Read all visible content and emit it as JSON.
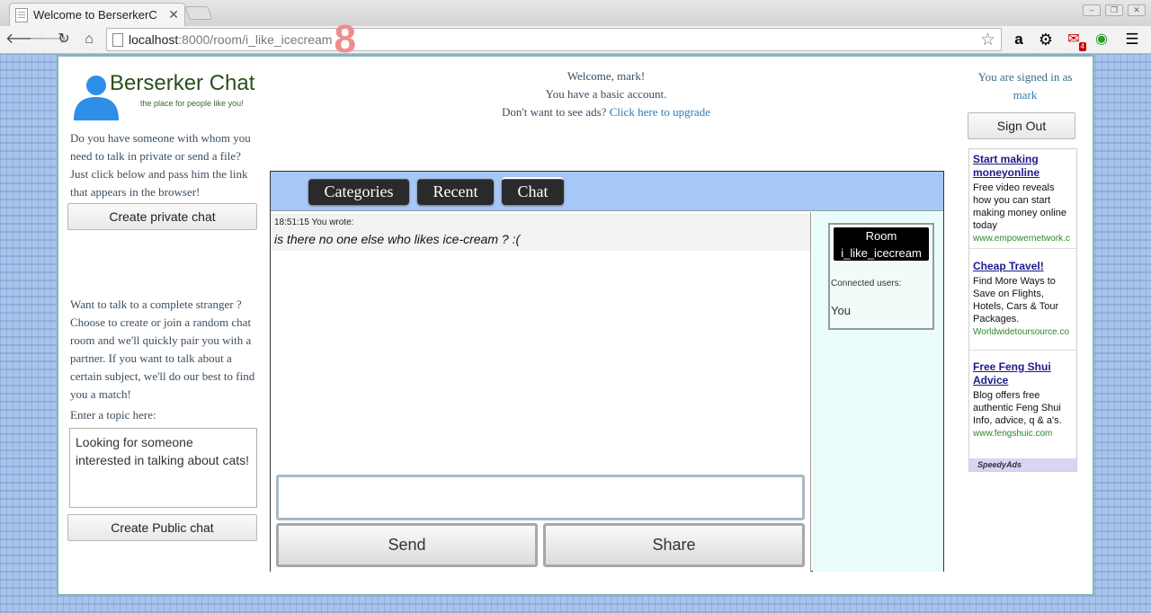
{
  "browser": {
    "tab_title": "Welcome to BerserkerC",
    "url_host": "localhost",
    "url_path": ":8000/room/i_like_icecream",
    "url_badge": "8",
    "notification_count": "4"
  },
  "site": {
    "title": "Berserker Chat",
    "tagline": "the place for people like you!"
  },
  "left": {
    "private_text": "Do you have someone with whom you need to talk in private or send a file? Just click below and pass him the link that appears in the browser!",
    "private_button": "Create private chat",
    "stranger_text": "Want to talk to a complete stranger ? Choose to create or join a random chat room and we'll quickly pair you with a partner. If you want to talk about a certain subject, we'll do our best to find you a match!",
    "topic_label": "Enter a topic here:",
    "topic_value": "Looking for someone interested in talking about cats!",
    "public_button": "Create Public chat"
  },
  "welcome": {
    "line1": "Welcome, mark!",
    "line2": "You have a basic account.",
    "line3_prefix": "Don't want to see ads?",
    "upgrade_link": "Click here to upgrade"
  },
  "account": {
    "signed_in_as": "You are signed in as",
    "username": "mark",
    "sign_out": "Sign Out"
  },
  "chat": {
    "tabs": [
      "Categories",
      "Recent",
      "Chat"
    ],
    "message": {
      "time": "18:51:15",
      "author": "You wrote:",
      "text": "is there no one else who likes ice-cream ? :("
    },
    "send": "Send",
    "share": "Share",
    "room_label": "Room",
    "room_name": "i_like_icecream",
    "connected_label": "Connected users:",
    "connected_users": [
      "You"
    ]
  },
  "ads": [
    {
      "title": "Start making moneyonline",
      "body": "Free video reveals how you can start making money online today",
      "url": "www.empowernetwork.c"
    },
    {
      "title": "Cheap Travel!",
      "body": "Find More Ways to Save on Flights, Hotels, Cars & Tour Packages.",
      "url": "Worldwidetoursource.co"
    },
    {
      "title": "Free Feng Shui Advice",
      "body": "Blog offers free authentic Feng Shui Info, advice, q & a's.",
      "url": "www.fengshuic.com"
    }
  ],
  "ads_footer": "SpeedyAds",
  "colors": {
    "accent_blue": "#a6c8f6",
    "brand_green": "#2a4f1c",
    "link_blue": "#2a7cb8"
  }
}
